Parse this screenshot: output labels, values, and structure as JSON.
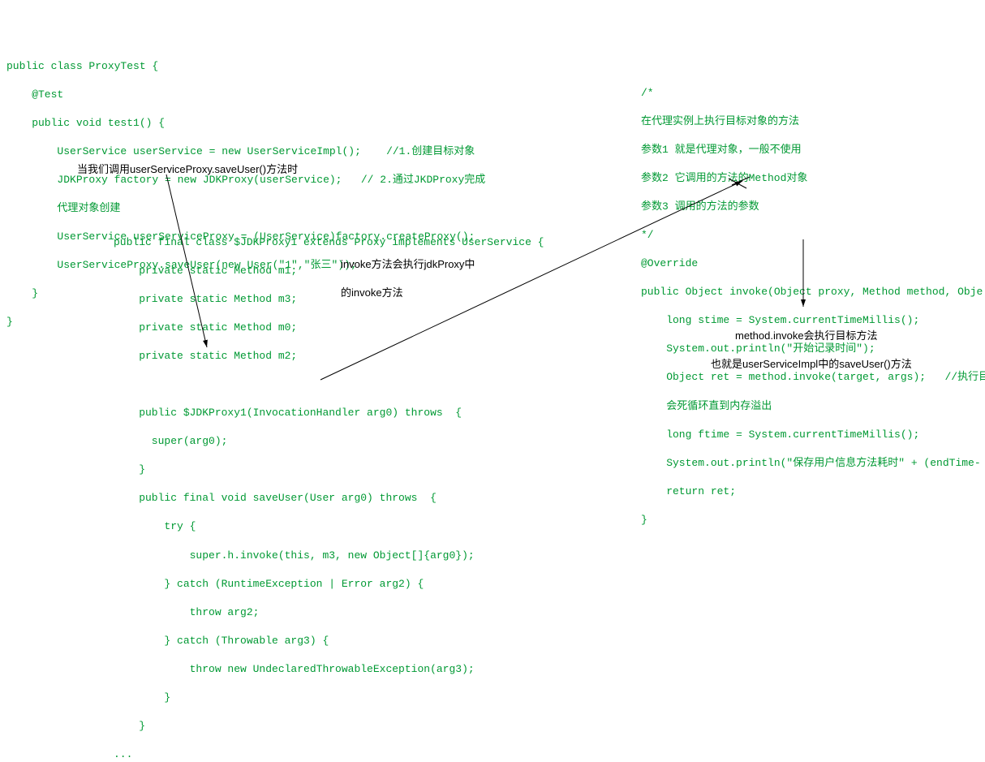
{
  "block1": {
    "l1": "public class ProxyTest {",
    "l2": "    @Test",
    "l3": "    public void test1() {",
    "l4": "        UserService userService = new UserServiceImpl();    //1.创建目标对象",
    "l5": "        JDKProxy factory = new JDKProxy(userService);   // 2.通过JKDProxy完成",
    "l6": "        代理对象创建",
    "l7": "        UserService userServiceProxy = (UserService)factory.createProxy();",
    "l8": "        UserServiceProxy.saveUser(new User(\"1\",\"张三\"));",
    "l9": "    }",
    "l10": "}"
  },
  "block2": {
    "l1": "public final class $JDKProxy1 extends Proxy implements UserService {",
    "l2": "    private static Method m1;",
    "l3": "    private static Method m3;",
    "l4": "    private static Method m0;",
    "l5": "    private static Method m2;",
    "l6": "",
    "l7": "    public $JDKProxy1(InvocationHandler arg0) throws  {",
    "l8": "      super(arg0);",
    "l9": "    }",
    "l10": "    public final void saveUser(User arg0) throws  {",
    "l11": "        try {",
    "l12": "            super.h.invoke(this, m3, new Object[]{arg0});",
    "l13": "        } catch (RuntimeException | Error arg2) {",
    "l14": "            throw arg2;",
    "l15": "        } catch (Throwable arg3) {",
    "l16": "            throw new UndeclaredThrowableException(arg3);",
    "l17": "        }",
    "l18": "    }",
    "l19": "..."
  },
  "block3": {
    "l1": "/*",
    "l2": "在代理实例上执行目标对象的方法",
    "l3": "参数1 就是代理对象，一般不使用",
    "l4": "参数2 它调用的方法的Method对象",
    "l5": "参数3 调用的方法的参数",
    "l6": "*/",
    "l7": "@Override",
    "l8": "public Object invoke(Object proxy, Method method, Obje",
    "l9": "    long stime = System.currentTimeMillis();",
    "l10": "    System.out.println(\"开始记录时间\");",
    "l11": "    Object ret = method.invoke(target, args);   //执行目",
    "l12": "    会死循环直到内存溢出",
    "l13": "    long ftime = System.currentTimeMillis();",
    "l14": "    System.out.println(\"保存用户信息方法耗时\" + (endTime-",
    "l15": "    return ret;",
    "l16": "}"
  },
  "annotations": {
    "a1": "当我们调用userServiceProxy.saveUser()方法时",
    "a2_l1": "invoke方法会执行jdkProxy中",
    "a2_l2": "的invoke方法",
    "a3_l1": "method.invoke会执行目标方法",
    "a3_l2": "也就是userServiceImpl中的saveUser()方法"
  }
}
